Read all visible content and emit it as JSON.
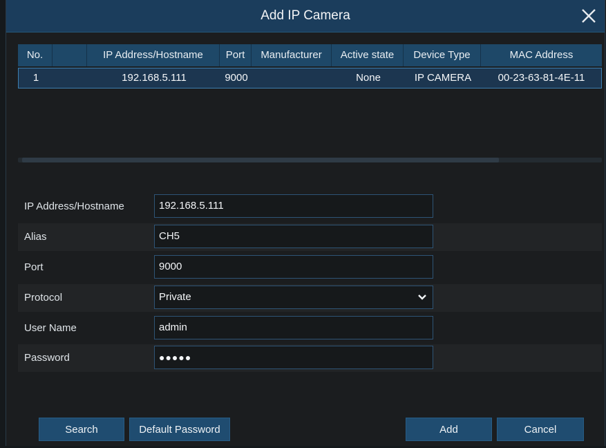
{
  "dialog": {
    "title": "Add IP Camera"
  },
  "table": {
    "headers": [
      "No.",
      "",
      "IP Address/Hostname",
      "Port",
      "Manufacturer",
      "Active state",
      "Device Type",
      "MAC Address"
    ],
    "rows": [
      {
        "no": "1",
        "ip": "192.168.5.111",
        "port": "9000",
        "manufacturer": "",
        "active_state": "None",
        "device_type": "IP CAMERA",
        "mac": "00-23-63-81-4E-11"
      }
    ]
  },
  "form": {
    "ip_label": "IP Address/Hostname",
    "ip_value": "192.168.5.111",
    "alias_label": "Alias",
    "alias_value": "CH5",
    "port_label": "Port",
    "port_value": "9000",
    "protocol_label": "Protocol",
    "protocol_value": "Private",
    "username_label": "User Name",
    "username_value": "admin",
    "password_label": "Password",
    "password_value": "●●●●●"
  },
  "buttons": {
    "search": "Search",
    "default_password": "Default Password",
    "add": "Add",
    "cancel": "Cancel"
  },
  "colors": {
    "titlebar": "#1b3d5c",
    "header": "#1e4868",
    "selected_border": "#3d7fb0",
    "button": "#1f4c70"
  }
}
